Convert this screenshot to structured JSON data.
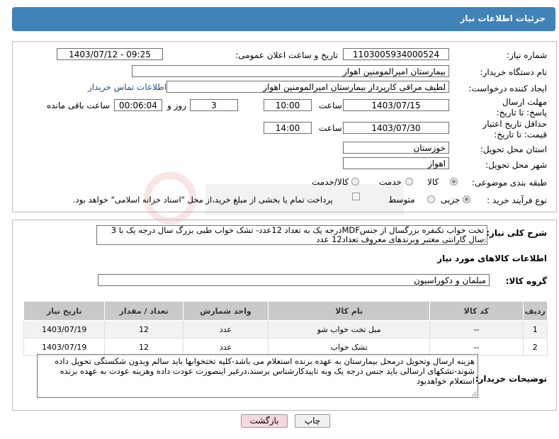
{
  "header": {
    "title": "جزئیات اطلاعات نیاز"
  },
  "form": {
    "need_number_label": "شماره نیاز:",
    "need_number": "1103005934000524",
    "announce_label": "تاریخ و ساعت اعلان عمومی:",
    "announce_value": "1403/07/12 - 09:25",
    "buyer_org_label": "نام دستگاه خریدار:",
    "buyer_org": "بیمارستان امیرالمومنین اهواز",
    "requester_label": "ایجاد کننده درخواست:",
    "requester": "لطیف مراقی کارپرداز بیمارستان امیرالمومنین اهواز",
    "contact_link": "اطلاعات تماس خریدار",
    "reply_deadline_label": "مهلت ارسال پاسخ: تا تاریخ:",
    "reply_date": "1403/07/15",
    "time_label": "ساعت",
    "reply_time": "10:00",
    "days_value": "3",
    "days_label": "روز و",
    "remaining_time": "00:06:04",
    "remaining_label": "ساعت باقی مانده",
    "price_validity_label": "حداقل تاریخ اعتبار قیمت: تا تاریخ:",
    "validity_date": "1403/07/30",
    "validity_time": "14:00",
    "province_label": "استان محل تحویل:",
    "province": "خوزستان",
    "city_label": "شهر محل تحویل:",
    "city": "اهواز",
    "category_label": "طبقه بندی موضوعی:",
    "category_options": [
      "کالا",
      "خدمت",
      "کالا/خدمت"
    ],
    "category_selected": "کالا",
    "process_label": "نوع فرآیند خرید :",
    "process_options": [
      "جزیی",
      "متوسط"
    ],
    "process_selected": "جزیی",
    "payment_note": "پرداخت تمام یا بخشی از مبلغ خرید،از محل \"اسناد خزانه اسلامی\" خواهد بود.",
    "general_desc_label": "شرح کلی نیاز:",
    "general_desc": "تخت خواب تکنفره بزرگسال از جنسMDFدرجه یک به تعداد 12عدد-  تشک خواب طبی بزرگ سال درجه یک با 3 سال گارانتی معتبر وبرندهای معروف  تعداد12 عدد",
    "goods_info_title": "اطلاعات کالاهای مورد نیاز",
    "goods_group_label": "گروه کالا:",
    "goods_group": "مبلمان و دکوراسیون",
    "buyer_notes_label": "توضیحات خریدار:",
    "buyer_notes": "هزینه ارسال وتحویل درمحل بیمارستان به عهده برنده استعلام می باشد-کلیه تختخوابها باید سالم وبدون شکستگی تحویل داده شوند-تشکهای ارسالی باید جنس درجه یک وبه تاییدکارشناس برسند،درغیر اینصورت عودت داده وهزینه عودت به عهده برنده استعلام خواهدبود"
  },
  "table": {
    "headers": [
      "ردیف",
      "کد کالا",
      "نام کالا",
      "واحد شمارش",
      "تعداد / مقدار",
      "تاریخ نیاز"
    ],
    "rows": [
      [
        "1",
        "--",
        "مبل تخت خواب شو",
        "عدد",
        "12",
        "1403/07/19"
      ],
      [
        "2",
        "--",
        "تشک خواب",
        "عدد",
        "12",
        "1403/07/19"
      ]
    ]
  },
  "buttons": {
    "print": "چاپ",
    "back": "بازگشت"
  },
  "colors": {
    "header_bg": "#3f83b8",
    "back_btn_bg": "#f6d9df",
    "link": "#1a4f8a"
  }
}
